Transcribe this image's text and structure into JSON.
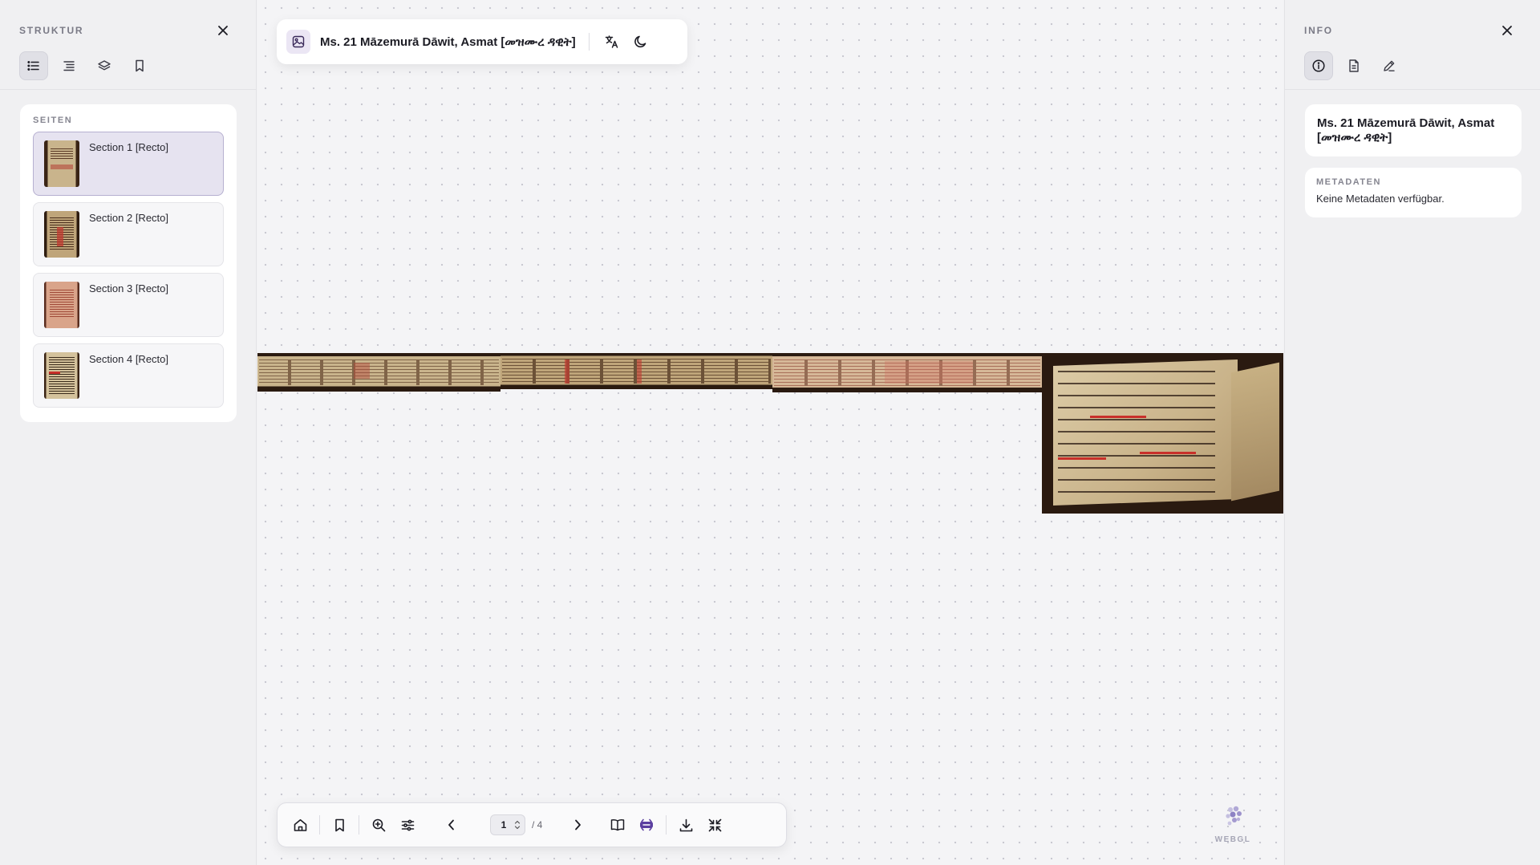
{
  "left_panel": {
    "title": "STRUKTUR",
    "tools": [
      {
        "name": "list-view",
        "icon": "list-icon",
        "active": true
      },
      {
        "name": "outline-view",
        "icon": "outline-icon",
        "active": false
      },
      {
        "name": "layers-view",
        "icon": "layers-icon",
        "active": false
      },
      {
        "name": "bookmarks-view",
        "icon": "bookmark-icon",
        "active": false
      }
    ],
    "pages_label": "SEITEN",
    "pages": [
      {
        "label": "Section 1 [Recto]",
        "selected": true
      },
      {
        "label": "Section 2 [Recto]",
        "selected": false
      },
      {
        "label": "Section 3 [Recto]",
        "selected": false
      },
      {
        "label": "Section 4 [Recto]",
        "selected": false
      }
    ]
  },
  "viewer": {
    "title": "Ms. 21 Māzemurā Dāwit, Asmat [መዝሙረ ዳዊት]",
    "title_icon": "image-icon",
    "actions": [
      "translate-icon",
      "moon-icon"
    ]
  },
  "toolbar": {
    "current_page": "1",
    "total_pages": "/ 4",
    "buttons": [
      "home-icon",
      "bookmark-icon",
      "zoom-in-icon",
      "sliders-icon",
      "chevron-left-icon",
      "chevron-right-icon",
      "book-icon",
      "scroll-mode-icon",
      "download-icon",
      "collapse-icon"
    ]
  },
  "logo": {
    "text": "WEBGL"
  },
  "right_panel": {
    "title": "INFO",
    "tools": [
      {
        "name": "info-tab",
        "icon": "info-icon",
        "active": true
      },
      {
        "name": "document-tab",
        "icon": "document-icon",
        "active": false
      },
      {
        "name": "annotate-tab",
        "icon": "pen-icon",
        "active": false
      }
    ],
    "doc_title": "Ms. 21 Māzemurā Dāwit, Asmat [መዝሙረ ዳዊት]",
    "metadata_label": "METADATEN",
    "metadata_value": "Keine Metadaten verfügbar."
  },
  "colors": {
    "accent": "#5b3fa0",
    "selected_bg": "#e6e3f0",
    "parchment": "#d8c9a8",
    "rubric_red": "#c8302a"
  }
}
